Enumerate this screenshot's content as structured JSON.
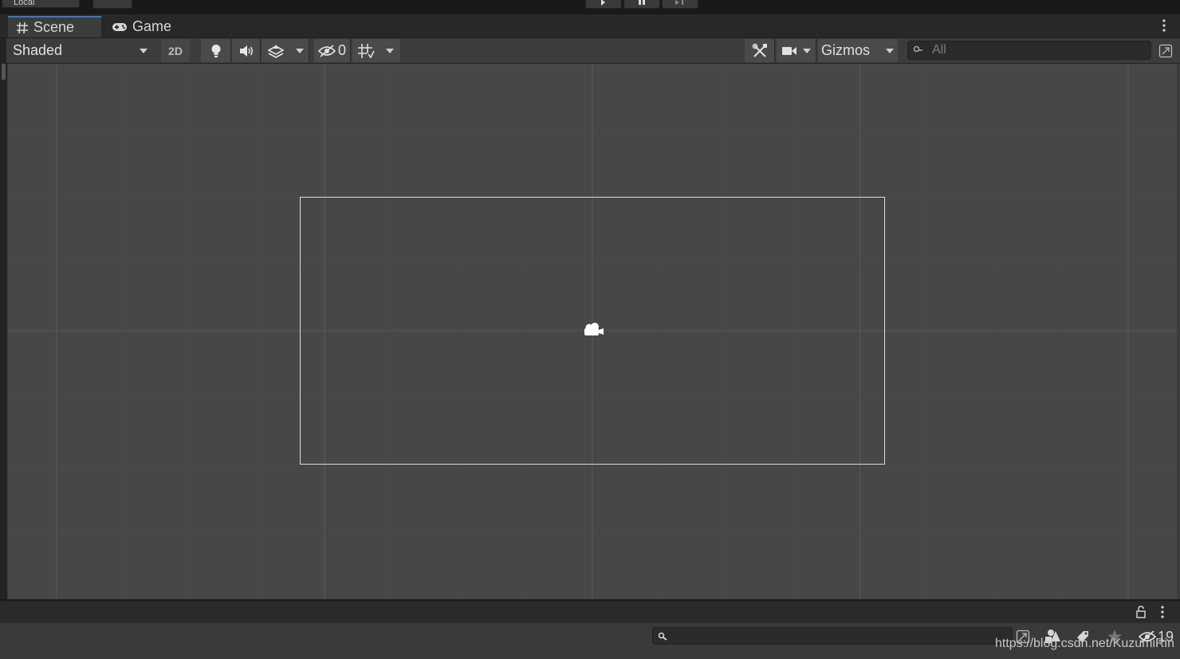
{
  "topbar": {
    "local_label": "Local",
    "play_icon": "play-icon",
    "pause_icon": "pause-icon",
    "step_icon": "step-icon"
  },
  "tabs": [
    {
      "label": "Scene",
      "icon": "grid-hash-icon",
      "active": true
    },
    {
      "label": "Game",
      "icon": "gamepad-icon",
      "active": false
    }
  ],
  "toolbar": {
    "shading_mode": "Shaded",
    "mode_2d": "2D",
    "hidden_count": "0",
    "gizmos_label": "Gizmos",
    "search_placeholder": "All"
  },
  "bottom": {
    "hidden_count": "19",
    "search_placeholder": ""
  },
  "watermark": "https://blog.csdn.net/KuzumiRin",
  "colors": {
    "accent": "#3a79bb",
    "scene_bg": "#474747",
    "panel_bg": "#3c3c3c",
    "dark_bg": "#282828"
  }
}
